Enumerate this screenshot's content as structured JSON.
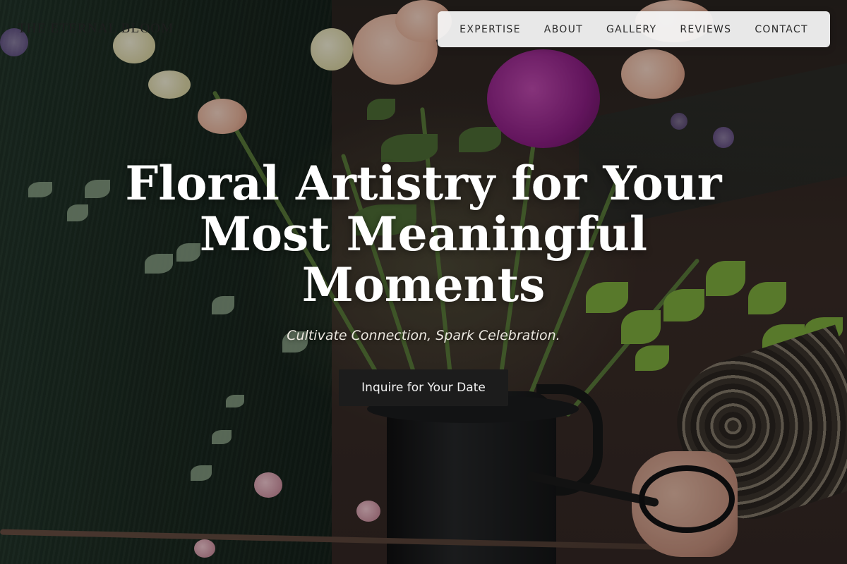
{
  "site": {
    "logo_text": "THE ETERNAL BLOOM"
  },
  "nav": {
    "items": [
      {
        "label": "EXPERTISE"
      },
      {
        "label": "ABOUT"
      },
      {
        "label": "GALLERY"
      },
      {
        "label": "REVIEWS"
      },
      {
        "label": "CONTACT"
      }
    ]
  },
  "hero": {
    "headline_lines": [
      "Floral Artistry for Your",
      "Most Meaningful",
      "Moments"
    ],
    "tagline": "Cultivate Connection, Spark Celebration.",
    "cta_label": "Inquire for Your Date",
    "background_image": "florist arranging bouquet in black pitcher vase, hand holding shears"
  },
  "colors": {
    "nav_background": "#f5f5f5",
    "cta_background": "#1c1c1c",
    "headline_text": "#ffffff"
  }
}
